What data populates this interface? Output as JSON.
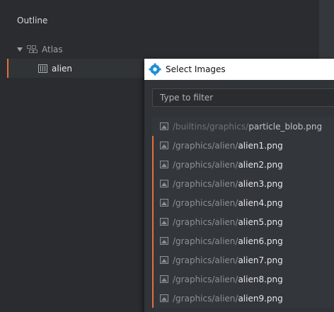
{
  "outline": {
    "title": "Outline",
    "tree": [
      {
        "label": "Atlas",
        "icon": "atlas-icon",
        "expanded": true
      },
      {
        "label": "alien",
        "icon": "animation-icon",
        "selected": true
      }
    ]
  },
  "dialog": {
    "title": "Select Images",
    "filter_placeholder": "Type to filter",
    "items": [
      {
        "path": "/builtins/graphics/",
        "file": "particle_blob.png"
      },
      {
        "path": "/graphics/alien/",
        "file": "alien1.png"
      },
      {
        "path": "/graphics/alien/",
        "file": "alien2.png"
      },
      {
        "path": "/graphics/alien/",
        "file": "alien3.png"
      },
      {
        "path": "/graphics/alien/",
        "file": "alien4.png"
      },
      {
        "path": "/graphics/alien/",
        "file": "alien5.png"
      },
      {
        "path": "/graphics/alien/",
        "file": "alien6.png"
      },
      {
        "path": "/graphics/alien/",
        "file": "alien7.png"
      },
      {
        "path": "/graphics/alien/",
        "file": "alien8.png"
      },
      {
        "path": "/graphics/alien/",
        "file": "alien9.png"
      }
    ]
  },
  "colors": {
    "accent": "#e0713c",
    "panel": "#2a2c2f",
    "dialog": "#303337"
  }
}
